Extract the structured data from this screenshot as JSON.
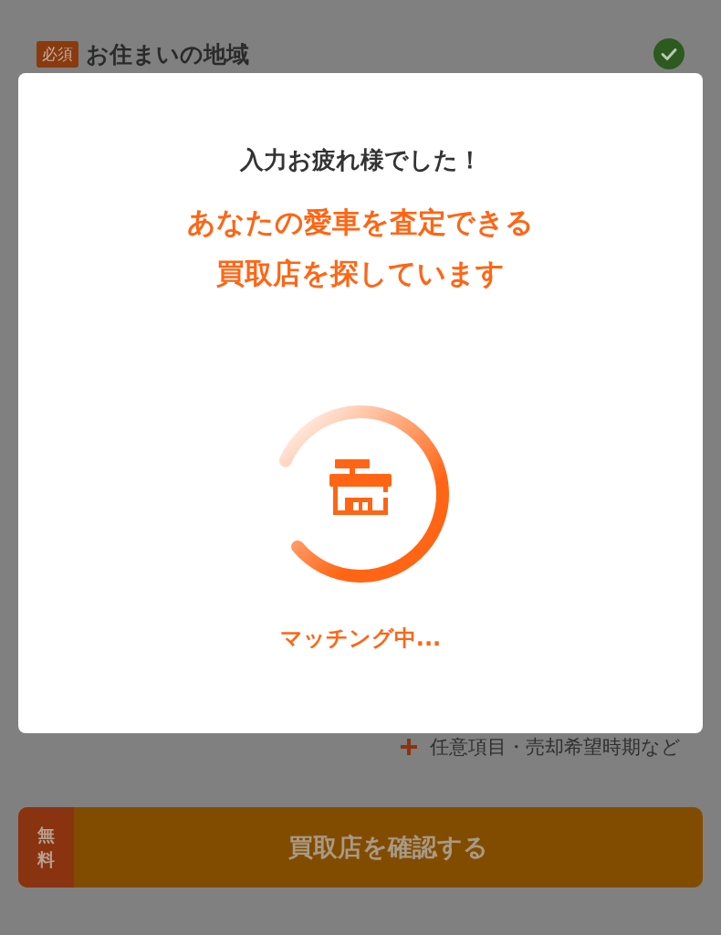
{
  "form": {
    "field": {
      "badge": "必須",
      "label": "お住まいの地域",
      "completed": true
    },
    "optional_link": {
      "label": "任意項目・売却希望時期など"
    }
  },
  "submit_button": {
    "badge": "無料",
    "label": "買取店を確認する"
  },
  "modal": {
    "title": "入力お疲れ様でした！",
    "message_lines": [
      "あなたの愛車を査定できる",
      "買取店を探しています"
    ],
    "status": "マッチング中..."
  }
}
